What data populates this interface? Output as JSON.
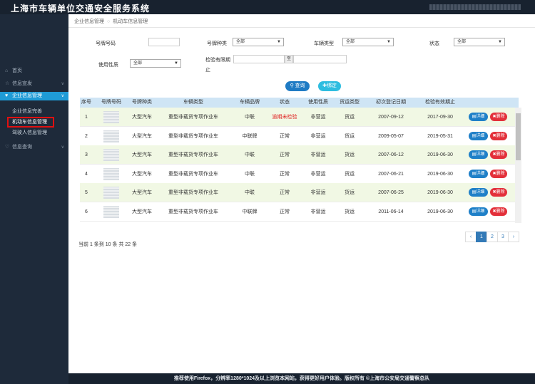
{
  "app": {
    "title": "上海市车辆单位交通安全服务系统"
  },
  "sidebar": {
    "items": [
      {
        "label": "首页",
        "icon": "home-icon"
      },
      {
        "label": "信息宣发",
        "icon": "star-icon"
      },
      {
        "label": "企业信息管理",
        "icon": "heart-icon"
      },
      {
        "label": "信息查询",
        "icon": "heart-icon"
      }
    ],
    "sub_items": [
      {
        "label": "企业信息完善"
      },
      {
        "label": "机动车信息管理"
      },
      {
        "label": "驾驶人信息管理"
      }
    ]
  },
  "breadcrumb": {
    "parent": "企业信息管理",
    "current": "机动车信息管理"
  },
  "filters": {
    "plate_number_label": "号牌号码",
    "plate_type_label": "号牌种类",
    "plate_type_value": "全部",
    "vehicle_type_label": "车辆类型",
    "vehicle_type_value": "全部",
    "status_label": "状态",
    "status_value": "全部",
    "usage_label": "使用性质",
    "usage_value": "全部",
    "inspection_label_1": "检验有限期",
    "inspection_label_2": "止",
    "range_sep": "至",
    "query_button": "查询",
    "bind_button": "绑定"
  },
  "table": {
    "headers": [
      "序号",
      "号牌号码",
      "号牌种类",
      "车辆类型",
      "车辆品牌",
      "状态",
      "使用性质",
      "货运类型",
      "初次登记日期",
      "检验有效期止"
    ],
    "rows": [
      {
        "no": "1",
        "plate_type": "大型汽车",
        "vehicle_type": "重型非载货专项作业车",
        "brand": "中联",
        "status": "逾期未检验",
        "usage": "非营运",
        "freight": "货运",
        "reg_date": "2007-09-12",
        "valid_until": "2017-09-30"
      },
      {
        "no": "2",
        "plate_type": "大型汽车",
        "vehicle_type": "重型非载货专项作业车",
        "brand": "中联牌",
        "status": "正常",
        "usage": "非营运",
        "freight": "货运",
        "reg_date": "2009-05-07",
        "valid_until": "2019-05-31"
      },
      {
        "no": "3",
        "plate_type": "大型汽车",
        "vehicle_type": "重型非载货专项作业车",
        "brand": "中联",
        "status": "正常",
        "usage": "非营运",
        "freight": "货运",
        "reg_date": "2007-06-12",
        "valid_until": "2019-06-30"
      },
      {
        "no": "4",
        "plate_type": "大型汽车",
        "vehicle_type": "重型非载货专项作业车",
        "brand": "中联",
        "status": "正常",
        "usage": "非营运",
        "freight": "货运",
        "reg_date": "2007-06-21",
        "valid_until": "2019-06-30"
      },
      {
        "no": "5",
        "plate_type": "大型汽车",
        "vehicle_type": "重型非载货专项作业车",
        "brand": "中联",
        "status": "正常",
        "usage": "非营运",
        "freight": "货运",
        "reg_date": "2007-06-25",
        "valid_until": "2019-06-30"
      },
      {
        "no": "6",
        "plate_type": "大型汽车",
        "vehicle_type": "重型非载货专项作业车",
        "brand": "中联牌",
        "status": "正常",
        "usage": "非营运",
        "freight": "货运",
        "reg_date": "2011-06-14",
        "valid_until": "2019-06-30"
      }
    ],
    "detail_label": "详细",
    "delete_label": "删除"
  },
  "summary": "当前 1 条到 10 条 共 22 条",
  "pager": {
    "prev": "‹",
    "pages": [
      "1",
      "2",
      "3"
    ],
    "next": "›"
  },
  "footer": "推荐使用Firefox，分辨率1280*1024及以上浏览本网站，获得更好用户体验。版权所有 ©上海市公安局交通警察总队",
  "colors": {
    "accent": "#1f9bd6",
    "danger": "#e3303a",
    "header_bg": "#cfe5f5"
  }
}
